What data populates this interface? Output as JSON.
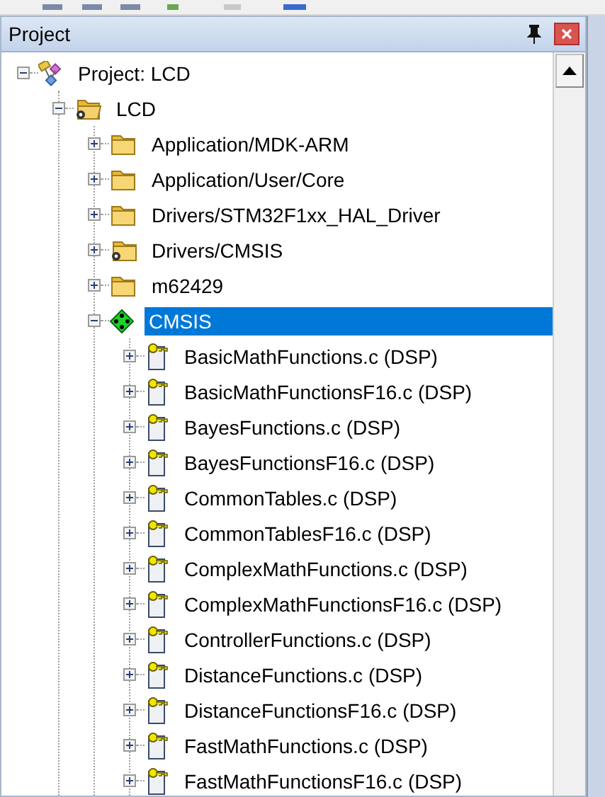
{
  "panel": {
    "title": "Project"
  },
  "tree": [
    {
      "label": "Project: LCD",
      "kind": "project",
      "expanded": true,
      "selected": false,
      "children": [
        {
          "label": "LCD",
          "kind": "target",
          "expanded": true,
          "selected": false,
          "children": [
            {
              "label": "Application/MDK-ARM",
              "kind": "folder",
              "expanded": false,
              "selected": false
            },
            {
              "label": "Application/User/Core",
              "kind": "folder",
              "expanded": false,
              "selected": false
            },
            {
              "label": "Drivers/STM32F1xx_HAL_Driver",
              "kind": "folder",
              "expanded": false,
              "selected": false
            },
            {
              "label": "Drivers/CMSIS",
              "kind": "folder-gear",
              "expanded": false,
              "selected": false
            },
            {
              "label": "m62429",
              "kind": "folder",
              "expanded": false,
              "selected": false
            },
            {
              "label": "CMSIS",
              "kind": "component",
              "expanded": true,
              "selected": true,
              "children": [
                {
                  "label": "BasicMathFunctions.c (DSP)",
                  "kind": "file",
                  "expanded": false,
                  "selected": false
                },
                {
                  "label": "BasicMathFunctionsF16.c (DSP)",
                  "kind": "file",
                  "expanded": false,
                  "selected": false
                },
                {
                  "label": "BayesFunctions.c (DSP)",
                  "kind": "file",
                  "expanded": false,
                  "selected": false
                },
                {
                  "label": "BayesFunctionsF16.c (DSP)",
                  "kind": "file",
                  "expanded": false,
                  "selected": false
                },
                {
                  "label": "CommonTables.c (DSP)",
                  "kind": "file",
                  "expanded": false,
                  "selected": false
                },
                {
                  "label": "CommonTablesF16.c (DSP)",
                  "kind": "file",
                  "expanded": false,
                  "selected": false
                },
                {
                  "label": "ComplexMathFunctions.c (DSP)",
                  "kind": "file",
                  "expanded": false,
                  "selected": false
                },
                {
                  "label": "ComplexMathFunctionsF16.c (DSP)",
                  "kind": "file",
                  "expanded": false,
                  "selected": false
                },
                {
                  "label": "ControllerFunctions.c (DSP)",
                  "kind": "file",
                  "expanded": false,
                  "selected": false
                },
                {
                  "label": "DistanceFunctions.c (DSP)",
                  "kind": "file",
                  "expanded": false,
                  "selected": false
                },
                {
                  "label": "DistanceFunctionsF16.c (DSP)",
                  "kind": "file",
                  "expanded": false,
                  "selected": false
                },
                {
                  "label": "FastMathFunctions.c (DSP)",
                  "kind": "file",
                  "expanded": false,
                  "selected": false
                },
                {
                  "label": "FastMathFunctionsF16.c (DSP)",
                  "kind": "file",
                  "expanded": false,
                  "selected": false
                }
              ]
            }
          ]
        }
      ]
    }
  ]
}
